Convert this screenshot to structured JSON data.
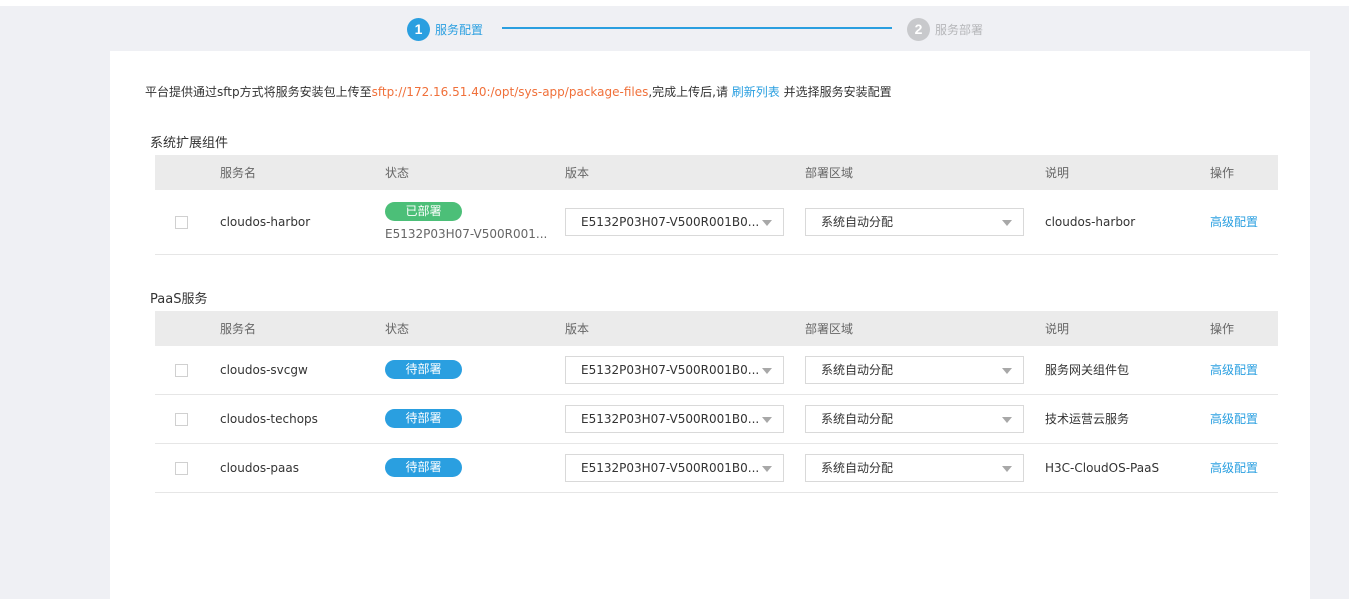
{
  "stepper": {
    "steps": [
      {
        "number": "1",
        "label": "服务配置",
        "state": "active"
      },
      {
        "number": "2",
        "label": "服务部署",
        "state": "inactive"
      }
    ]
  },
  "notice": {
    "prefix": "平台提供通过sftp方式将服务安装包上传至",
    "path": "sftp://172.16.51.40:/opt/sys-app/package-files",
    "middle": ",完成上传后,请 ",
    "link": "刷新列表",
    "suffix": " 并选择服务安装配置"
  },
  "columns": [
    "服务名",
    "状态",
    "版本",
    "部署区域",
    "说明",
    "操作"
  ],
  "sections": [
    {
      "title": "系统扩展组件",
      "rows": [
        {
          "name": "cloudos-harbor",
          "status": "已部署",
          "status_type": "deployed",
          "status_detail": "E5132P03H07-V500R001...",
          "version": "E5132P03H07-V500R001B0...",
          "zone": "系统自动分配",
          "desc": "cloudos-harbor",
          "op": "高级配置"
        }
      ]
    },
    {
      "title": "PaaS服务",
      "rows": [
        {
          "name": "cloudos-svcgw",
          "status": "待部署",
          "status_type": "pending",
          "status_detail": "",
          "version": "E5132P03H07-V500R001B0...",
          "zone": "系统自动分配",
          "desc": "服务网关组件包",
          "op": "高级配置"
        },
        {
          "name": "cloudos-techops",
          "status": "待部署",
          "status_type": "pending",
          "status_detail": "",
          "version": "E5132P03H07-V500R001B0...",
          "zone": "系统自动分配",
          "desc": "技术运营云服务",
          "op": "高级配置"
        },
        {
          "name": "cloudos-paas",
          "status": "待部署",
          "status_type": "pending",
          "status_detail": "",
          "version": "E5132P03H07-V500R001B0...",
          "zone": "系统自动分配",
          "desc": "H3C-CloudOS-PaaS",
          "op": "高级配置"
        }
      ]
    }
  ],
  "colors": {
    "accent": "#2a9fe0",
    "deployed": "#4cbf78",
    "path": "#f0703a",
    "step_inactive": "#c8c9cc"
  }
}
